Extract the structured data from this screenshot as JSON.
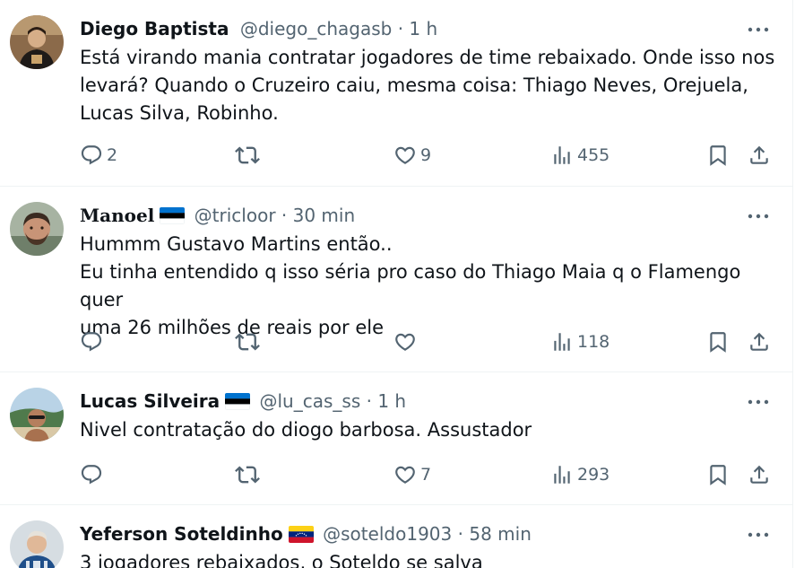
{
  "tweets": [
    {
      "name": "Diego Baptista",
      "flag": "",
      "handle": "@diego_chagasb",
      "separator": "·",
      "time": "1 h",
      "text": "Está virando mania contratar jogadores de time rebaixado. Onde isso nos\nlevará? Quando o Cruzeiro caiu, mesma coisa: Thiago Neves, Orejuela,\nLucas Silva, Robinho.",
      "replies": "2",
      "reposts": "",
      "likes": "9",
      "views": "455"
    },
    {
      "name": "𝐌𝐚𝐧𝐨𝐞𝐥",
      "flag": "estonia-flag",
      "handle": "@tricloor",
      "separator": "·",
      "time": "30 min",
      "text": "Hummm Gustavo Martins então..\nEu tinha entendido q isso séria pro caso do Thiago Maia q o Flamengo quer\numa 26 milhões de reais por ele",
      "replies": "",
      "reposts": "",
      "likes": "",
      "views": "118"
    },
    {
      "name": "Lucas Silveira",
      "flag": "estonia-flag",
      "handle": "@lu_cas_ss",
      "separator": "·",
      "time": "1 h",
      "text": "Nivel contratação do diogo barbosa. Assustador",
      "replies": "",
      "reposts": "",
      "likes": "7",
      "views": "293"
    },
    {
      "name": "Yeferson Soteldinho",
      "flag": "venezuela-flag",
      "handle": "@soteldo1903",
      "separator": "·",
      "time": "58 min",
      "text": "3 jogadores rebaixados, o Soteldo se salva",
      "replies": "",
      "reposts": "",
      "likes": "",
      "views": ""
    }
  ],
  "icons": {
    "reply": "reply-icon",
    "repost": "repost-icon",
    "like": "heart-icon",
    "views": "views-icon",
    "bookmark": "bookmark-icon",
    "share": "share-icon",
    "more": "more-icon"
  },
  "colors": {
    "text_primary": "#0f1419",
    "text_secondary": "#536471",
    "divider": "#eff3f4"
  }
}
